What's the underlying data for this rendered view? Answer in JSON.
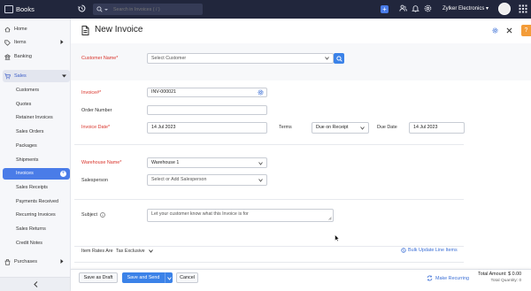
{
  "app": {
    "title": "Books"
  },
  "topbar": {
    "search_placeholder": "Search in Invoices ( / )",
    "quick_add": "+",
    "org_name": "Zylker Electronics ▾"
  },
  "sidebar": {
    "items": [
      {
        "label": "Home"
      },
      {
        "label": "Items"
      },
      {
        "label": "Banking"
      },
      {
        "label": "Sales"
      },
      {
        "label": "Purchases"
      }
    ],
    "sales_sub": [
      {
        "label": "Customers"
      },
      {
        "label": "Quotes"
      },
      {
        "label": "Retainer Invoices"
      },
      {
        "label": "Sales Orders"
      },
      {
        "label": "Packages"
      },
      {
        "label": "Shipments"
      },
      {
        "label": "Invoices"
      },
      {
        "label": "Sales Receipts"
      },
      {
        "label": "Payments Received"
      },
      {
        "label": "Recurring Invoices"
      },
      {
        "label": "Sales Returns"
      },
      {
        "label": "Credit Notes"
      }
    ],
    "active": "Invoices"
  },
  "form": {
    "title": "New Invoice",
    "customer_label": "Customer Name*",
    "customer_placeholder": "Select Customer",
    "invoice_no_label": "Invoice#*",
    "invoice_no_value": "INV-000021",
    "order_no_label": "Order Number",
    "order_no_value": "",
    "invoice_date_label": "Invoice Date*",
    "invoice_date_value": "14 Jul 2023",
    "terms_label": "Terms",
    "terms_value": "Due on Receipt",
    "due_date_label": "Due Date",
    "due_date_value": "14 Jul 2023",
    "warehouse_label": "Warehouse Name*",
    "warehouse_value": "Warehouse 1",
    "salesperson_label": "Salesperson",
    "salesperson_placeholder": "Select or Add Salesperson",
    "subject_label": "Subject",
    "subject_placeholder": "Let your customer know what this Invoice is for",
    "rates_label": "Item Rates Are",
    "rates_value": "Tax Exclusive",
    "bulk_update": "Bulk Update Line Items"
  },
  "footer": {
    "save_draft": "Save as Draft",
    "save_send": "Save and Send",
    "cancel": "Cancel",
    "make_recurring": "Make Recurring",
    "total_amount": "Total Amount: $ 0.00",
    "total_quantity": "Total Quantity: 0"
  },
  "colors": {
    "primary": "#3b82e8",
    "topbar": "#21263c",
    "required": "#d9342b",
    "help": "#f39c38"
  }
}
